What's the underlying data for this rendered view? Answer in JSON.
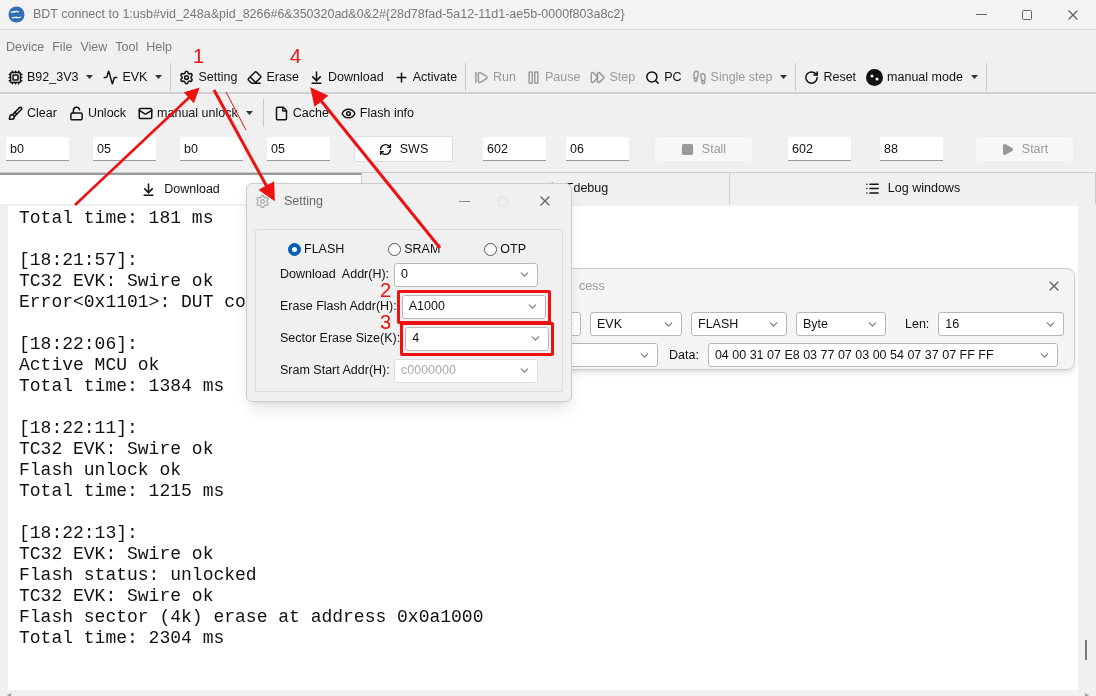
{
  "window": {
    "title": "BDT connect to 1:usb#vid_248a&pid_8266#6&350320ad&0&2#{28d78fad-5a12-11d1-ae5b-0000f803a8c2}"
  },
  "menu": [
    "Device",
    "File",
    "View",
    "Tool",
    "Help"
  ],
  "toolbar": [
    [
      {
        "label": "B92_3V3",
        "kind": "combo",
        "disabled": false
      },
      {
        "label": "EVK",
        "kind": "combo",
        "disabled": false
      }
    ],
    [
      {
        "label": "Setting",
        "kind": "button",
        "disabled": false
      },
      {
        "label": "Erase",
        "kind": "button",
        "disabled": false
      },
      {
        "label": "Download",
        "kind": "button",
        "disabled": false
      },
      {
        "label": "Activate",
        "kind": "button",
        "disabled": false
      }
    ],
    [
      {
        "label": "Run",
        "kind": "button",
        "disabled": true
      },
      {
        "label": "Pause",
        "kind": "button",
        "disabled": true
      },
      {
        "label": "Step",
        "kind": "button",
        "disabled": true
      },
      {
        "label": "PC",
        "kind": "button",
        "disabled": false
      },
      {
        "label": "Single step",
        "kind": "combo",
        "disabled": true
      }
    ],
    [
      {
        "label": "Reset",
        "kind": "button",
        "disabled": false
      },
      {
        "label": "manual mode",
        "kind": "combo",
        "disabled": false
      }
    ]
  ],
  "toolbar2": [
    [
      {
        "label": "Clear",
        "kind": "button"
      },
      {
        "label": "Unlock",
        "kind": "button"
      },
      {
        "label": "manual unlock",
        "kind": "combo"
      }
    ],
    [
      {
        "label": "Cache",
        "kind": "button"
      },
      {
        "label": "Flash info",
        "kind": "button"
      }
    ]
  ],
  "register_row": [
    {
      "kind": "field",
      "value": "b0"
    },
    {
      "kind": "field",
      "value": "05"
    },
    {
      "kind": "field",
      "value": "b0"
    },
    {
      "kind": "field",
      "value": "05"
    },
    {
      "kind": "button",
      "label": "SWS",
      "disabled": false
    },
    {
      "kind": "field",
      "value": "602"
    },
    {
      "kind": "field",
      "value": "06"
    },
    {
      "kind": "button",
      "label": "Stall",
      "disabled": true
    },
    {
      "kind": "field",
      "value": "602"
    },
    {
      "kind": "field",
      "value": "88"
    },
    {
      "kind": "button",
      "label": "Start",
      "disabled": true
    }
  ],
  "tabs": [
    {
      "label": "Download",
      "selected": true
    },
    {
      "label": "Tdebug",
      "selected": false
    },
    {
      "label": "Log windows",
      "selected": false
    }
  ],
  "log": [
    [
      "Total time: 181 ms"
    ],
    [
      "[18:21:57]:",
      "TC32 EVK: Swire ok",
      "Error<0x1101>: DUT co"
    ],
    [
      "[18:22:06]:",
      "Active MCU ok",
      "Total time: 1384 ms"
    ],
    [
      "[18:22:11]:",
      "TC32 EVK: Swire ok",
      "Flash unlock ok",
      "Total time: 1215 ms"
    ],
    [
      "[18:22:13]:",
      "TC32 EVK: Swire ok",
      "Flash status: unlocked",
      "TC32 EVK: Swire ok",
      "Flash sector (4k) erase at address 0x0a1000",
      "Total time: 2304 ms"
    ]
  ],
  "memory_dialog": {
    "title": "cess",
    "row1": [
      {
        "kind": "combo"
      },
      {
        "kind": "combo",
        "value": "EVK"
      },
      {
        "kind": "combo",
        "value": "FLASH"
      },
      {
        "kind": "combo",
        "value": "Byte"
      }
    ],
    "len_label": "Len:",
    "len_value": "16",
    "data_label": "Data:",
    "data_value": "04 00 31 07 E8 03 77 07 03 00 54 07 37 07 FF FF"
  },
  "setting_dialog": {
    "title": "Setting",
    "radios": [
      {
        "label": "FLASH",
        "selected": true
      },
      {
        "label": "SRAM",
        "selected": false
      },
      {
        "label": "OTP",
        "selected": false
      }
    ],
    "fields": [
      {
        "label": "Download  Addr(H):",
        "value": "0",
        "disabled": false,
        "highlighted": false
      },
      {
        "label": "Erase Flash Addr(H):",
        "value": "A1000",
        "disabled": false,
        "highlighted": true
      },
      {
        "label": "Sector Erase Size(K):",
        "value": "4",
        "disabled": false,
        "highlighted": true
      },
      {
        "label": "Sram Start Addr(H):",
        "value": "c0000000",
        "disabled": true,
        "highlighted": false
      }
    ]
  },
  "annotations": [
    {
      "label": "1"
    },
    {
      "label": "4"
    },
    {
      "label": "2"
    },
    {
      "label": "3"
    }
  ]
}
